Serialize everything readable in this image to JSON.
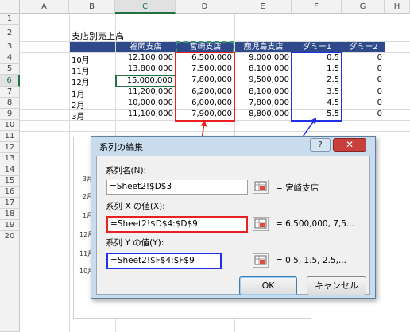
{
  "sheet": {
    "col_headers": [
      "A",
      "B",
      "C",
      "D",
      "E",
      "F",
      "G",
      "H"
    ],
    "row_headers": [
      "1",
      "2",
      "3",
      "4",
      "5",
      "6",
      "7",
      "8",
      "9",
      "10",
      "11",
      "12",
      "13",
      "14",
      "15",
      "16",
      "17",
      "18",
      "19",
      "20"
    ],
    "title": "支店別売上高",
    "table_headers": [
      "福岡支店",
      "宮崎支店",
      "鹿児島支店",
      "ダミー1",
      "ダミー2"
    ],
    "rows": [
      {
        "month": "10月",
        "fukuoka": "12,100,000",
        "miyazaki": "6,500,000",
        "kagoshima": "9,000,000",
        "dummy1": "0.5",
        "dummy2": "0"
      },
      {
        "month": "11月",
        "fukuoka": "13,800,000",
        "miyazaki": "7,500,000",
        "kagoshima": "8,100,000",
        "dummy1": "1.5",
        "dummy2": "0"
      },
      {
        "month": "12月",
        "fukuoka": "15,000,000",
        "miyazaki": "7,800,000",
        "kagoshima": "9,500,000",
        "dummy1": "2.5",
        "dummy2": "0"
      },
      {
        "month": "1月",
        "fukuoka": "11,200,000",
        "miyazaki": "6,200,000",
        "kagoshima": "8,100,000",
        "dummy1": "3.5",
        "dummy2": "0"
      },
      {
        "month": "2月",
        "fukuoka": "10,000,000",
        "miyazaki": "6,000,000",
        "kagoshima": "7,800,000",
        "dummy1": "4.5",
        "dummy2": "0"
      },
      {
        "month": "3月",
        "fukuoka": "11,100,000",
        "miyazaki": "7,900,000",
        "kagoshima": "8,800,000",
        "dummy1": "5.5",
        "dummy2": "0"
      }
    ],
    "chart_axis_labels": [
      "3月",
      "2月",
      "1月",
      "12月",
      "11月",
      "10月"
    ],
    "colors": {
      "header_fill": "#2e4a8b",
      "red_box": "#e82020",
      "blue_box": "#2030e8"
    }
  },
  "dialog": {
    "title": "系列の編集",
    "help_label": "?",
    "close_label": "✕",
    "series_name_label": "系列名(N):",
    "series_name_value": "=Sheet2!$D$3",
    "series_name_result": "= 宮崎支店",
    "x_label": "系列 X の値(X):",
    "x_value": "=Sheet2!$D$4:$D$9",
    "x_result": "= 6,500,000, 7,5...",
    "y_label": "系列 Y の値(Y):",
    "y_value": "=Sheet2!$F$4:$F$9",
    "y_result": "= 0.5, 1.5, 2.5,...",
    "ok_label": "OK",
    "cancel_label": "キャンセル"
  }
}
